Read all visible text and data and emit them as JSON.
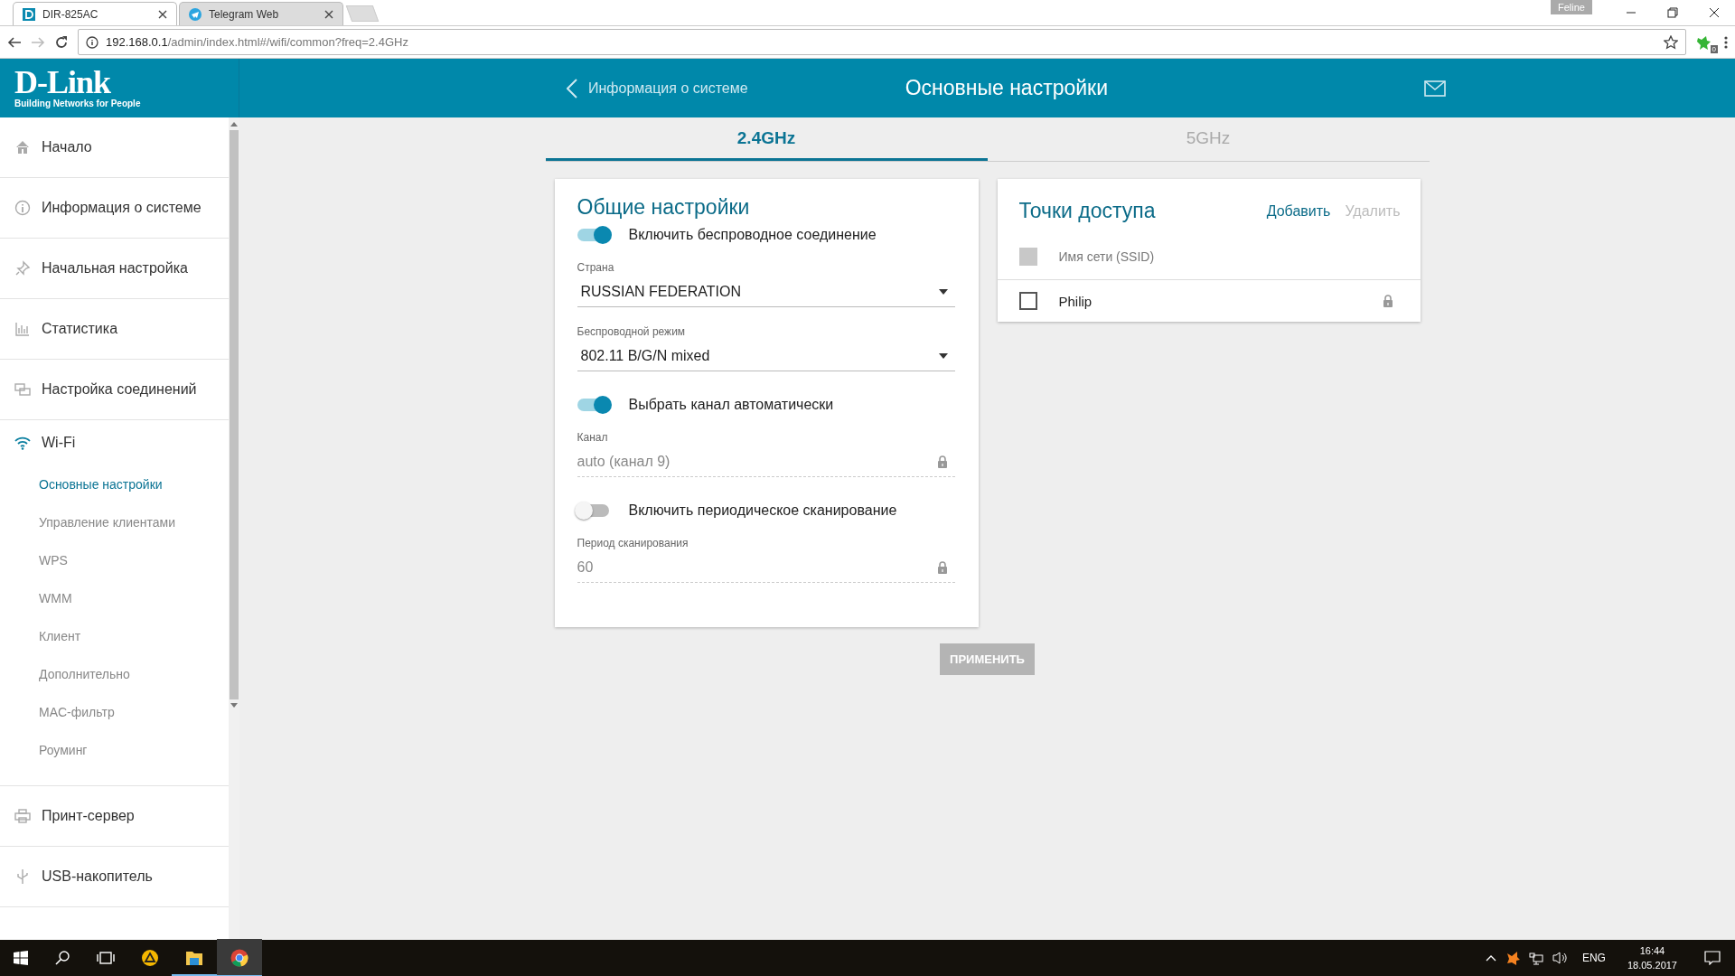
{
  "browser": {
    "tabs": [
      {
        "title": "DIR-825AC",
        "selected": true
      },
      {
        "title": "Telegram Web",
        "selected": false
      }
    ],
    "profile": "Feline",
    "url_host": "192.168.0.1",
    "url_path": "/admin/index.html#/wifi/common?freq=2.4GHz",
    "extension_badge": "0"
  },
  "logo": {
    "name": "D-Link",
    "tagline": "Building Networks for People"
  },
  "header": {
    "back_link": "Информация о системе",
    "title": "Основные настройки"
  },
  "sidebar": {
    "items": [
      {
        "label": "Начало",
        "expanded": false
      },
      {
        "label": "Информация о системе",
        "expanded": false
      },
      {
        "label": "Начальная настройка",
        "expanded": false
      },
      {
        "label": "Статистика",
        "expanded": false
      },
      {
        "label": "Настройка соединений",
        "expanded": false
      },
      {
        "label": "Wi-Fi",
        "expanded": true,
        "children": [
          {
            "label": "Основные настройки",
            "selected": true
          },
          {
            "label": "Управление клиентами",
            "selected": false
          },
          {
            "label": "WPS",
            "selected": false
          },
          {
            "label": "WMM",
            "selected": false
          },
          {
            "label": "Клиент",
            "selected": false
          },
          {
            "label": "Дополнительно",
            "selected": false
          },
          {
            "label": "MAC-фильтр",
            "selected": false
          },
          {
            "label": "Роуминг",
            "selected": false
          }
        ]
      },
      {
        "label": "Принт-сервер",
        "expanded": false
      },
      {
        "label": "USB-накопитель",
        "expanded": false
      }
    ]
  },
  "freq_tabs": [
    {
      "label": "2.4GHz",
      "selected": true
    },
    {
      "label": "5GHz",
      "selected": false
    }
  ],
  "general": {
    "title": "Общие настройки",
    "fields": [
      {
        "kind": "toggle",
        "label": "Включить беспроводное соединение",
        "on": true
      },
      {
        "kind": "select",
        "label": "Страна",
        "value": "RUSSIAN FEDERATION"
      },
      {
        "kind": "select",
        "label": "Беспроводной режим",
        "value": "802.11 B/G/N mixed"
      },
      {
        "kind": "toggle",
        "label": "Выбрать канал автоматически",
        "on": true
      },
      {
        "kind": "locked",
        "label": "Канал",
        "value": "auto (канал 9)",
        "disabled": true
      },
      {
        "kind": "toggle",
        "label": "Включить периодическое сканирование",
        "on": false
      },
      {
        "kind": "locked",
        "label": "Период сканирования",
        "value": "60",
        "disabled": true
      }
    ]
  },
  "access_points": {
    "title": "Точки доступа",
    "actions": [
      {
        "label": "Добавить",
        "disabled": false
      },
      {
        "label": "Удалить",
        "disabled": true
      }
    ],
    "select_all": {
      "disabled": true
    },
    "column": "Имя сети (SSID)",
    "rows": [
      {
        "ssid": "Philip",
        "checked": false
      }
    ]
  },
  "apply_button": {
    "label": "ПРИМЕНИТЬ",
    "disabled": true
  },
  "taskbar": {
    "language": "ENG",
    "time": "16:44",
    "date": "18.05.2017"
  }
}
